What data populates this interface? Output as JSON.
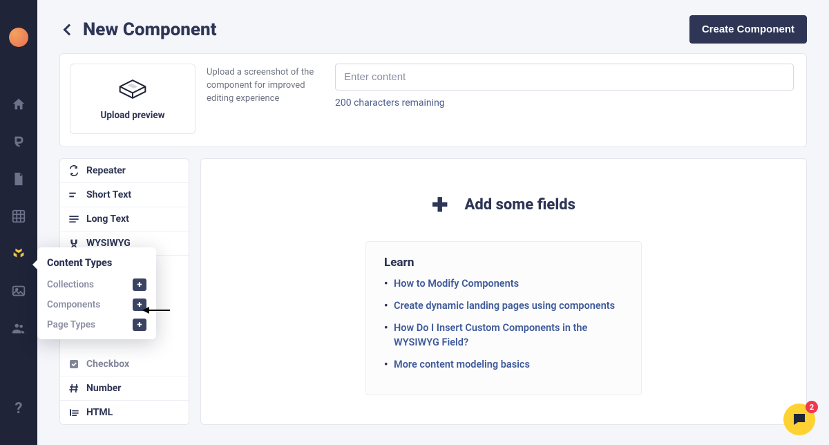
{
  "header": {
    "title": "New Component",
    "create_button": "Create Component"
  },
  "upload": {
    "thumb_label": "Upload preview",
    "description": "Upload a screenshot of the component for improved editing experience",
    "content_placeholder": "Enter content",
    "char_remaining": "200 characters remaining"
  },
  "fields": [
    "Repeater",
    "Short Text",
    "Long Text",
    "WYSIWYG",
    "Checkbox",
    "Number",
    "HTML"
  ],
  "main": {
    "add_fields": "Add some fields",
    "learn_title": "Learn",
    "learn_links": [
      "How to Modify Components",
      "Create dynamic landing pages using components",
      "How Do I Insert Custom Components in the WYSIWYG Field?",
      "More content modeling basics"
    ]
  },
  "popover": {
    "title": "Content Types",
    "items": [
      "Collections",
      "Components",
      "Page Types"
    ]
  },
  "chat": {
    "badge": "2"
  }
}
